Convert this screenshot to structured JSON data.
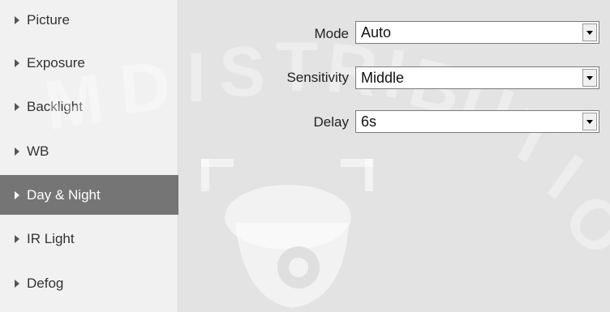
{
  "sidebar": {
    "items": [
      {
        "label": "Picture",
        "active": false
      },
      {
        "label": "Exposure",
        "active": false
      },
      {
        "label": "Backlight",
        "active": false
      },
      {
        "label": "WB",
        "active": false
      },
      {
        "label": "Day & Night",
        "active": true
      },
      {
        "label": "IR Light",
        "active": false
      },
      {
        "label": "Defog",
        "active": false
      }
    ]
  },
  "form": {
    "mode": {
      "label": "Mode",
      "value": "Auto"
    },
    "sensitivity": {
      "label": "Sensitivity",
      "value": "Middle"
    },
    "delay": {
      "label": "Delay",
      "value": "6s"
    }
  },
  "icons": {
    "sidebar_arrow": "caret-right-icon",
    "dropdown": "chevron-down-icon",
    "watermark_camera": "dome-camera-icon"
  },
  "colors": {
    "sidebar_bg": "#f1f1f1",
    "sidebar_active_bg": "#757575",
    "content_bg": "#e3e3e3",
    "select_bg": "#ffffff"
  },
  "watermark": {
    "text": "DISTRIBUTION"
  }
}
